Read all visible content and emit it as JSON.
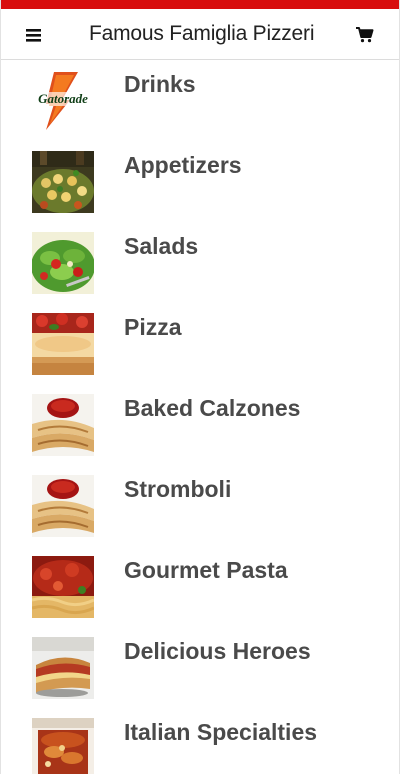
{
  "header": {
    "title": "Famous Famiglia Pizzeri",
    "menu_icon": "hamburger-menu-icon",
    "cart_icon": "shopping-cart-icon"
  },
  "colors": {
    "brand_red": "#d80d0d",
    "label_text": "#4a4a4a"
  },
  "menu": {
    "categories": [
      {
        "label": "Drinks",
        "image": "gatorade-logo-image"
      },
      {
        "label": "Appetizers",
        "image": "appetizers-image"
      },
      {
        "label": "Salads",
        "image": "salad-image"
      },
      {
        "label": "Pizza",
        "image": "pizza-image"
      },
      {
        "label": "Baked Calzones",
        "image": "calzone-image"
      },
      {
        "label": "Stromboli",
        "image": "stromboli-image"
      },
      {
        "label": "Gourmet Pasta",
        "image": "pasta-image"
      },
      {
        "label": "Delicious Heroes",
        "image": "hero-sandwich-image"
      },
      {
        "label": "Italian Specialties",
        "image": "italian-specialty-image"
      }
    ]
  }
}
